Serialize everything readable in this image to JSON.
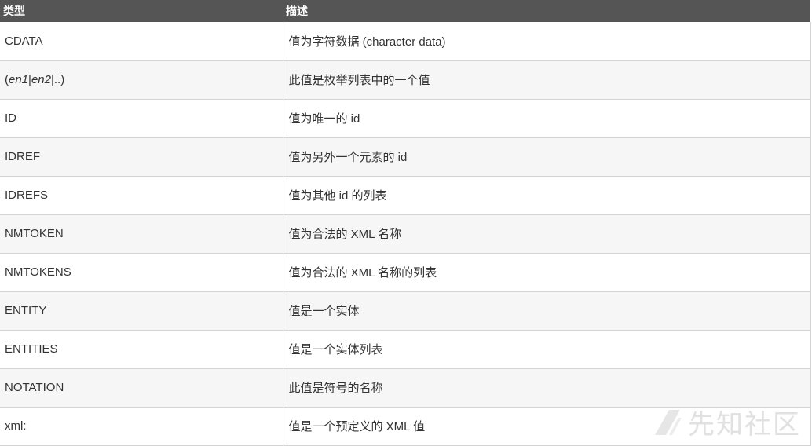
{
  "table": {
    "headers": [
      "类型",
      "描述"
    ],
    "rows": [
      {
        "type": "CDATA",
        "desc": "值为字符数据 (character data)"
      },
      {
        "type_parts": [
          "(",
          "en1",
          "|",
          "en2",
          "|..)"
        ],
        "desc": "此值是枚举列表中的一个值"
      },
      {
        "type": "ID",
        "desc": "值为唯一的 id"
      },
      {
        "type": "IDREF",
        "desc": "值为另外一个元素的 id"
      },
      {
        "type": "IDREFS",
        "desc": "值为其他 id 的列表"
      },
      {
        "type": "NMTOKEN",
        "desc": "值为合法的 XML 名称"
      },
      {
        "type": "NMTOKENS",
        "desc": "值为合法的 XML 名称的列表"
      },
      {
        "type": "ENTITY",
        "desc": "值是一个实体"
      },
      {
        "type": "ENTITIES",
        "desc": "值是一个实体列表"
      },
      {
        "type": "NOTATION",
        "desc": "此值是符号的名称"
      },
      {
        "type": "xml:",
        "desc": "值是一个预定义的 XML 值"
      }
    ]
  },
  "watermark": {
    "text": "先知社区",
    "icon": "xianzhi-logo-icon"
  },
  "colors": {
    "header_bg": "#555555",
    "header_text": "#ffffff",
    "row_alt_bg": "#f6f6f6",
    "border": "#d4d4d4"
  }
}
